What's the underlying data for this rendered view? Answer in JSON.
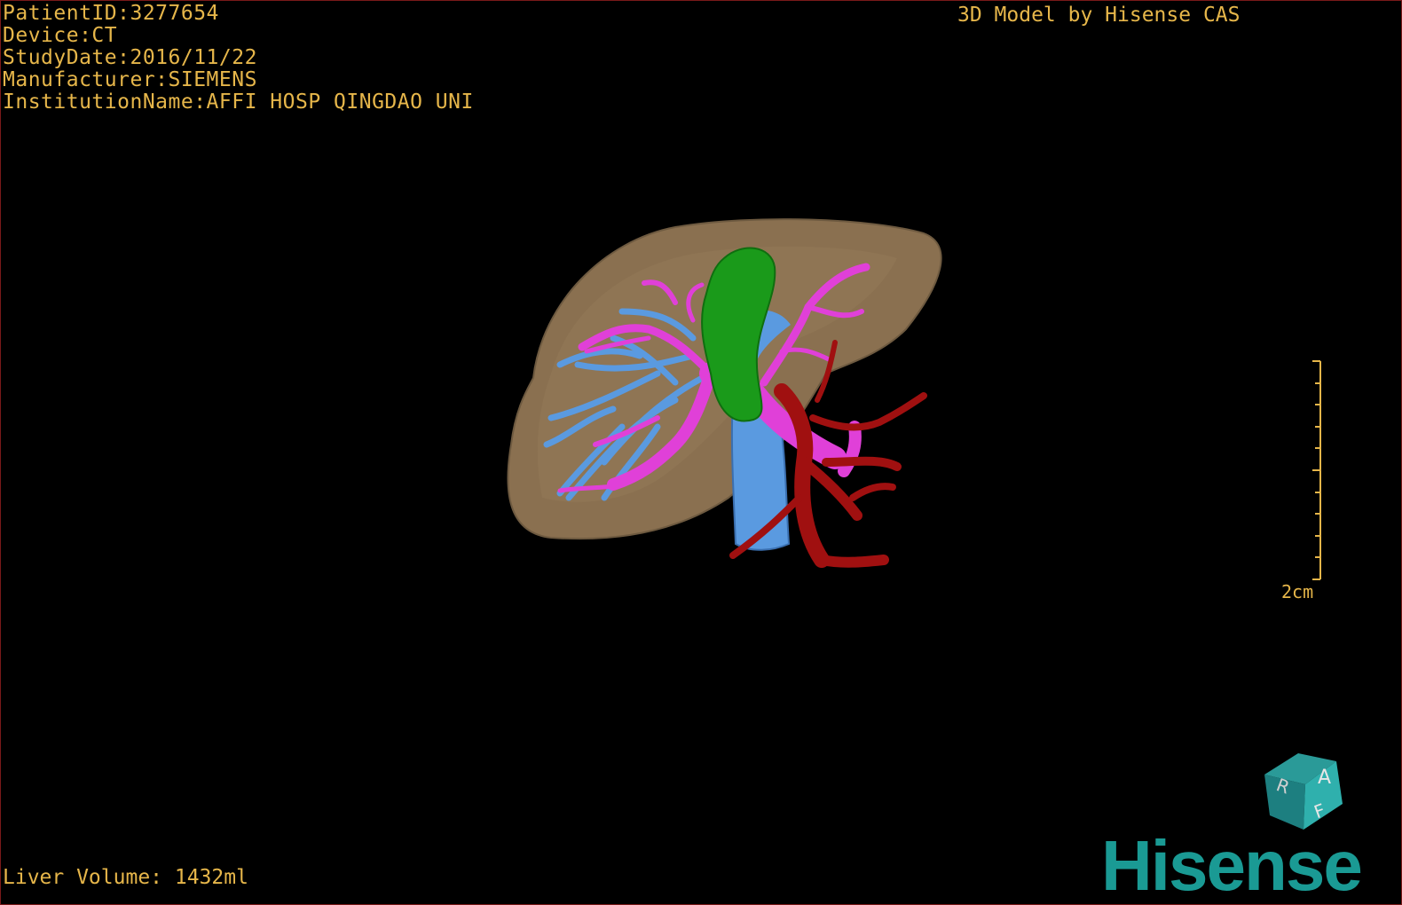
{
  "header": {
    "patient_id": "PatientID:3277654",
    "device": "Device:CT",
    "study_date": "StudyDate:2016/11/22",
    "manufacturer": "Manufacturer:SIEMENS",
    "institution": "InstitutionName:AFFI HOSP QINGDAO UNI"
  },
  "credit": "3D Model by Hisense CAS",
  "footer": {
    "liver_volume": "Liver Volume: 1432ml"
  },
  "scale_bar": {
    "label": "2cm"
  },
  "orientation_cube": {
    "faces": [
      "A",
      "R",
      "F"
    ]
  },
  "brand": {
    "logo_text": "Hisense"
  },
  "colors": {
    "overlay_text": "#e6b64a",
    "liver": "#8a7050",
    "gallbladder": "#1a9a1a",
    "hepatic_veins": "#5a9ae0",
    "portal_vein": "#e040d8",
    "artery": "#a01010",
    "brand": "#1a9a94"
  }
}
